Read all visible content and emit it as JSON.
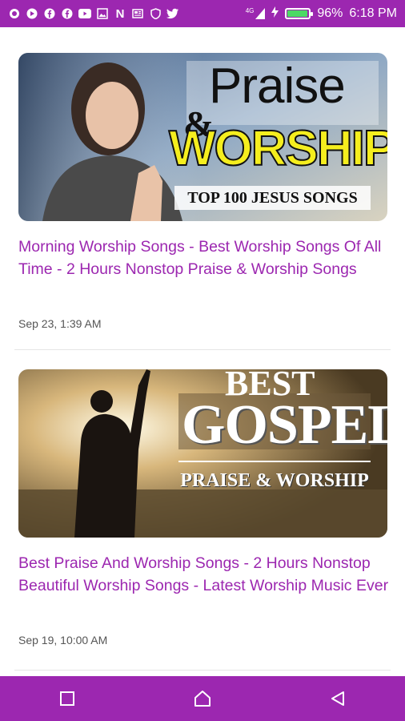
{
  "status_bar": {
    "battery_text": "96%",
    "time": "6:18 PM",
    "battery_level": 0.96,
    "network_label": "4G",
    "icons": [
      "record-icon",
      "play-store-icon",
      "facebook-icon",
      "facebook-icon",
      "youtube-icon",
      "image-icon",
      "netflix-icon",
      "news-icon",
      "shield-icon",
      "twitter-icon",
      "lte-signal-icon",
      "charging-icon",
      "battery-icon"
    ]
  },
  "feed": {
    "items": [
      {
        "title": "Morning Worship Songs - Best Worship Songs Of All Time - 2 Hours Nonstop Praise & Worship Songs",
        "date": "Sep 23, 1:39 AM",
        "thumb": {
          "line1": "Praise",
          "amp": "&",
          "line2": "WORSHIP",
          "banner": "TOP 100 JESUS SONGS"
        }
      },
      {
        "title": "Best Praise And Worship Songs - 2 Hours Nonstop Beautiful Worship Songs - Latest Worship Music Ever",
        "date": "Sep 19, 10:00 AM",
        "thumb": {
          "line1": "BEST",
          "line2": "GOSPEL",
          "banner": "PRAISE & WORSHIP"
        }
      }
    ]
  },
  "nav_bar": {
    "icons": [
      "recents-square-icon",
      "home-icon",
      "back-triangle-icon"
    ]
  },
  "colors": {
    "accent": "#9c27b0",
    "title_text": "#9c27b0",
    "date_text": "#555555",
    "battery_fill": "#4cd964",
    "worship_yellow": "#f5ee1e"
  }
}
